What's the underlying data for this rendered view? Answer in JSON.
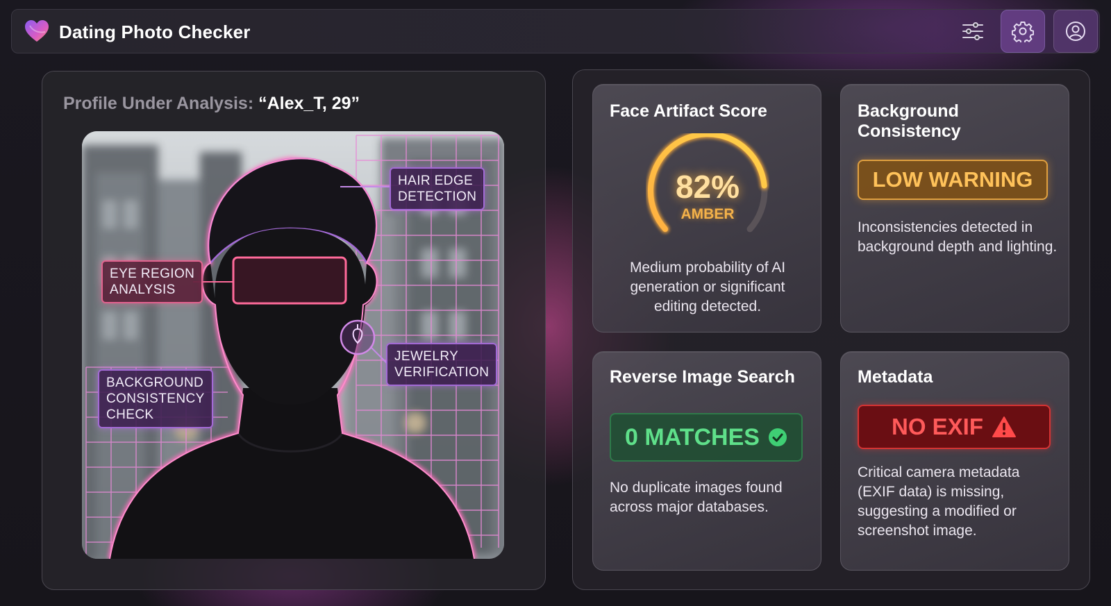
{
  "app": {
    "title": "Dating Photo Checker",
    "icons": {
      "logo": "heart-logo-icon",
      "filter": "sliders-icon",
      "settings": "gear-icon",
      "account": "user-icon"
    }
  },
  "profile": {
    "prefix": "Profile Under Analysis:",
    "name": "“Alex_T, 29”"
  },
  "photo_tags": {
    "hair": "HAIR EDGE\nDETECTION",
    "eye": "EYE REGION\nANALYSIS",
    "jewelry": "JEWELRY\nVERIFICATION",
    "background": "BACKGROUND\nCONSISTENCY\nCHECK"
  },
  "cards": {
    "face": {
      "title": "Face Artifact Score",
      "score_text": "82%",
      "score_fraction": 0.82,
      "level": "AMBER",
      "description": "Medium probability of AI generation or significant editing detected."
    },
    "background": {
      "title": "Background Consistency",
      "badge": "LOW WARNING",
      "description": "Inconsistencies detected in background depth and lighting."
    },
    "reverse": {
      "title": "Reverse Image Search",
      "badge": "0 MATCHES",
      "badge_icon": "check-circle-icon",
      "description": "No duplicate images found across major databases."
    },
    "metadata": {
      "title": "Metadata",
      "badge": "NO EXIF",
      "badge_icon": "warning-triangle-icon",
      "description": "Critical camera metadata (EXIF data) is missing, suggesting a modified or screenshot image."
    }
  },
  "colors": {
    "accent_pink": "#e2638f",
    "accent_purple": "#a36ad6",
    "amber": "#f4b24a",
    "success_green": "#5fe08a",
    "danger_red": "#ff5a5a"
  }
}
